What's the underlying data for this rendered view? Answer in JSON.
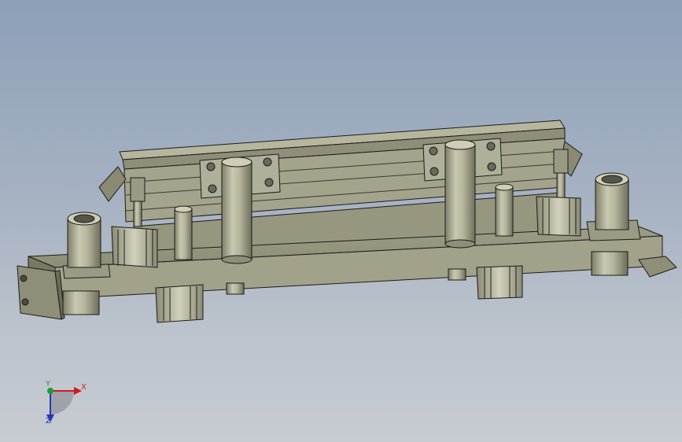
{
  "viewport": {
    "background_top": "#8d9fb8",
    "background_bottom": "#c7ccd2",
    "model_color": "#a8a790",
    "edge_color": "#1c1c1a"
  },
  "triad": {
    "x_label": "X",
    "y_label": "Y",
    "z_label": "Z",
    "x_color": "#d21a1a",
    "y_color": "#1d9a3a",
    "z_color": "#2436b8"
  }
}
